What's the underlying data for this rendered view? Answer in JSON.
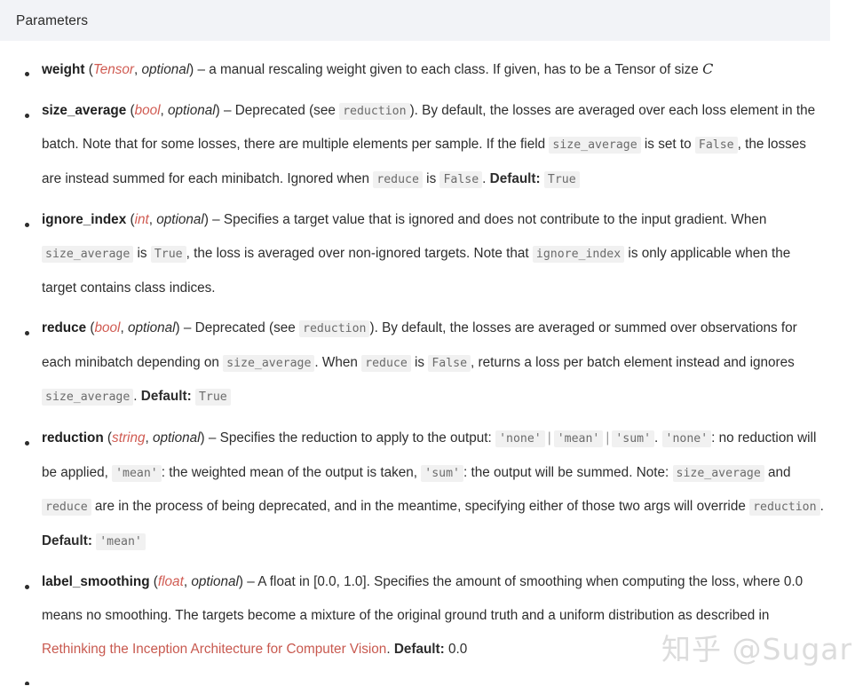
{
  "header": {
    "title": "Parameters",
    "band_color": "#f2f3f7"
  },
  "colors": {
    "type_annotation": "#d05b52",
    "link": "#c8594f",
    "code_bg": "#f1f1f1",
    "code_fg": "#6b6b6b",
    "text": "#2d2d2d"
  },
  "watermark": {
    "text": "知乎 @Sugar"
  },
  "parameters": [
    {
      "name": "weight",
      "type": "Tensor",
      "optional": "optional",
      "t1": " – a manual rescaling weight given to each class. If given, has to be a Tensor of size ",
      "math": "C",
      "t2": ""
    },
    {
      "name": "size_average",
      "type": "bool",
      "optional": "optional",
      "t1": " – Deprecated (see ",
      "c1": "reduction",
      "t2": "). By default, the losses are averaged over each loss element in the batch. Note that for some losses, there are multiple elements per sample. If the field ",
      "c2": "size_average",
      "t3": " is set to ",
      "c3": "False",
      "t4": ", the losses are instead summed for each minibatch. Ignored when ",
      "c4": "reduce",
      "t5": " is ",
      "c5": "False",
      "t6": ". ",
      "default_label": "Default:",
      "default_value": "True"
    },
    {
      "name": "ignore_index",
      "type": "int",
      "optional": "optional",
      "t1": " – Specifies a target value that is ignored and does not contribute to the input gradient. When ",
      "c1": "size_average",
      "t2": " is ",
      "c2": "True",
      "t3": ", the loss is averaged over non-ignored targets. Note that ",
      "c3": "ignore_index",
      "t4": " is only applicable when the target contains class indices."
    },
    {
      "name": "reduce",
      "type": "bool",
      "optional": "optional",
      "t1": " – Deprecated (see ",
      "c1": "reduction",
      "t2": "). By default, the losses are averaged or summed over observations for each minibatch depending on ",
      "c2": "size_average",
      "t3": ". When ",
      "c3": "reduce",
      "t4": " is ",
      "c4": "False",
      "t5": ", returns a loss per batch element instead and ignores ",
      "c5": "size_average",
      "t6": ". ",
      "default_label": "Default:",
      "default_value": "True"
    },
    {
      "name": "reduction",
      "type": "string",
      "optional": "optional",
      "t1": " – Specifies the reduction to apply to the output: ",
      "c1": "'none'",
      "bar1": "|",
      "c2": "'mean'",
      "bar2": "|",
      "c3": "'sum'",
      "t2": ". ",
      "c4": "'none'",
      "t3": ": no reduction will be applied, ",
      "c5": "'mean'",
      "t4": ": the weighted mean of the output is taken, ",
      "c6": "'sum'",
      "t5": ": the output will be summed. Note: ",
      "c7": "size_average",
      "t6": " and ",
      "c8": "reduce",
      "t7": " are in the process of being deprecated, and in the meantime, specifying either of those two args will override ",
      "c9": "reduction",
      "t8": ". ",
      "default_label": "Default:",
      "default_value": "'mean'"
    },
    {
      "name": "label_smoothing",
      "type": "float",
      "optional": "optional",
      "t1": " – A float in [0.0, 1.0]. Specifies the amount of smoothing when computing the loss, where 0.0 means no smoothing. The targets become a mixture of the original ground truth and a uniform distribution as described in ",
      "link": "Rethinking the Inception Architecture for Computer Vision",
      "t2": ". ",
      "default_label": "Default:",
      "default_value": "0.0"
    }
  ]
}
